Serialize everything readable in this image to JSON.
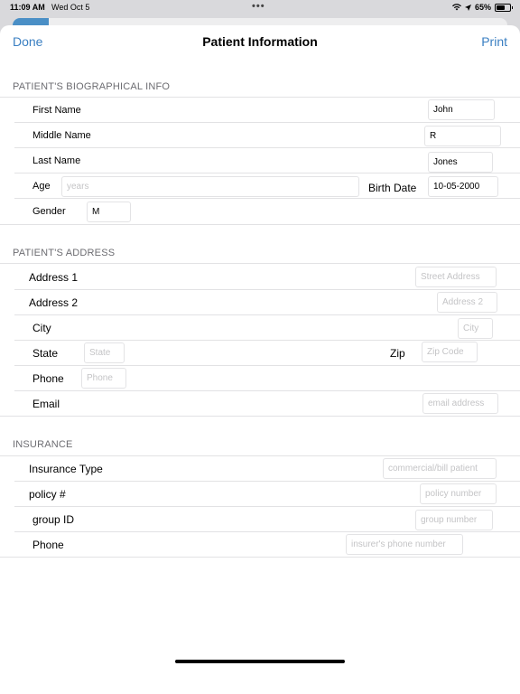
{
  "status": {
    "time": "11:09 AM",
    "date": "Wed Oct 5",
    "battery": "65%",
    "battery_level": 0.65
  },
  "nav": {
    "done": "Done",
    "title": "Patient Information",
    "print": "Print"
  },
  "bio": {
    "header": "PATIENT'S BIOGRAPHICAL INFO",
    "first_name": {
      "label": "First Name",
      "value": "John"
    },
    "middle_name": {
      "label": "Middle Name",
      "value": "R"
    },
    "last_name": {
      "label": "Last Name",
      "value": "Jones"
    },
    "age": {
      "label": "Age",
      "placeholder": "years"
    },
    "birth_date": {
      "label": "Birth Date",
      "value": "10-05-2000"
    },
    "gender": {
      "label": "Gender",
      "value": "M"
    }
  },
  "address": {
    "header": "PATIENT'S ADDRESS",
    "address1": {
      "label": "Address 1",
      "placeholder": "Street Address"
    },
    "address2": {
      "label": "Address 2",
      "placeholder": "Address 2"
    },
    "city": {
      "label": "City",
      "placeholder": "City"
    },
    "state": {
      "label": "State",
      "placeholder": "State"
    },
    "zip": {
      "label": "Zip",
      "placeholder": "Zip Code"
    },
    "phone": {
      "label": "Phone",
      "placeholder": "Phone"
    },
    "email": {
      "label": "Email",
      "placeholder": "email address"
    }
  },
  "insurance": {
    "header": "INSURANCE",
    "type": {
      "label": "Insurance Type",
      "placeholder": "commercial/bill patient"
    },
    "policy": {
      "label": "policy #",
      "placeholder": "policy number"
    },
    "group": {
      "label": "group ID",
      "placeholder": "group number"
    },
    "phone": {
      "label": "Phone",
      "placeholder": "insurer's phone number"
    }
  }
}
